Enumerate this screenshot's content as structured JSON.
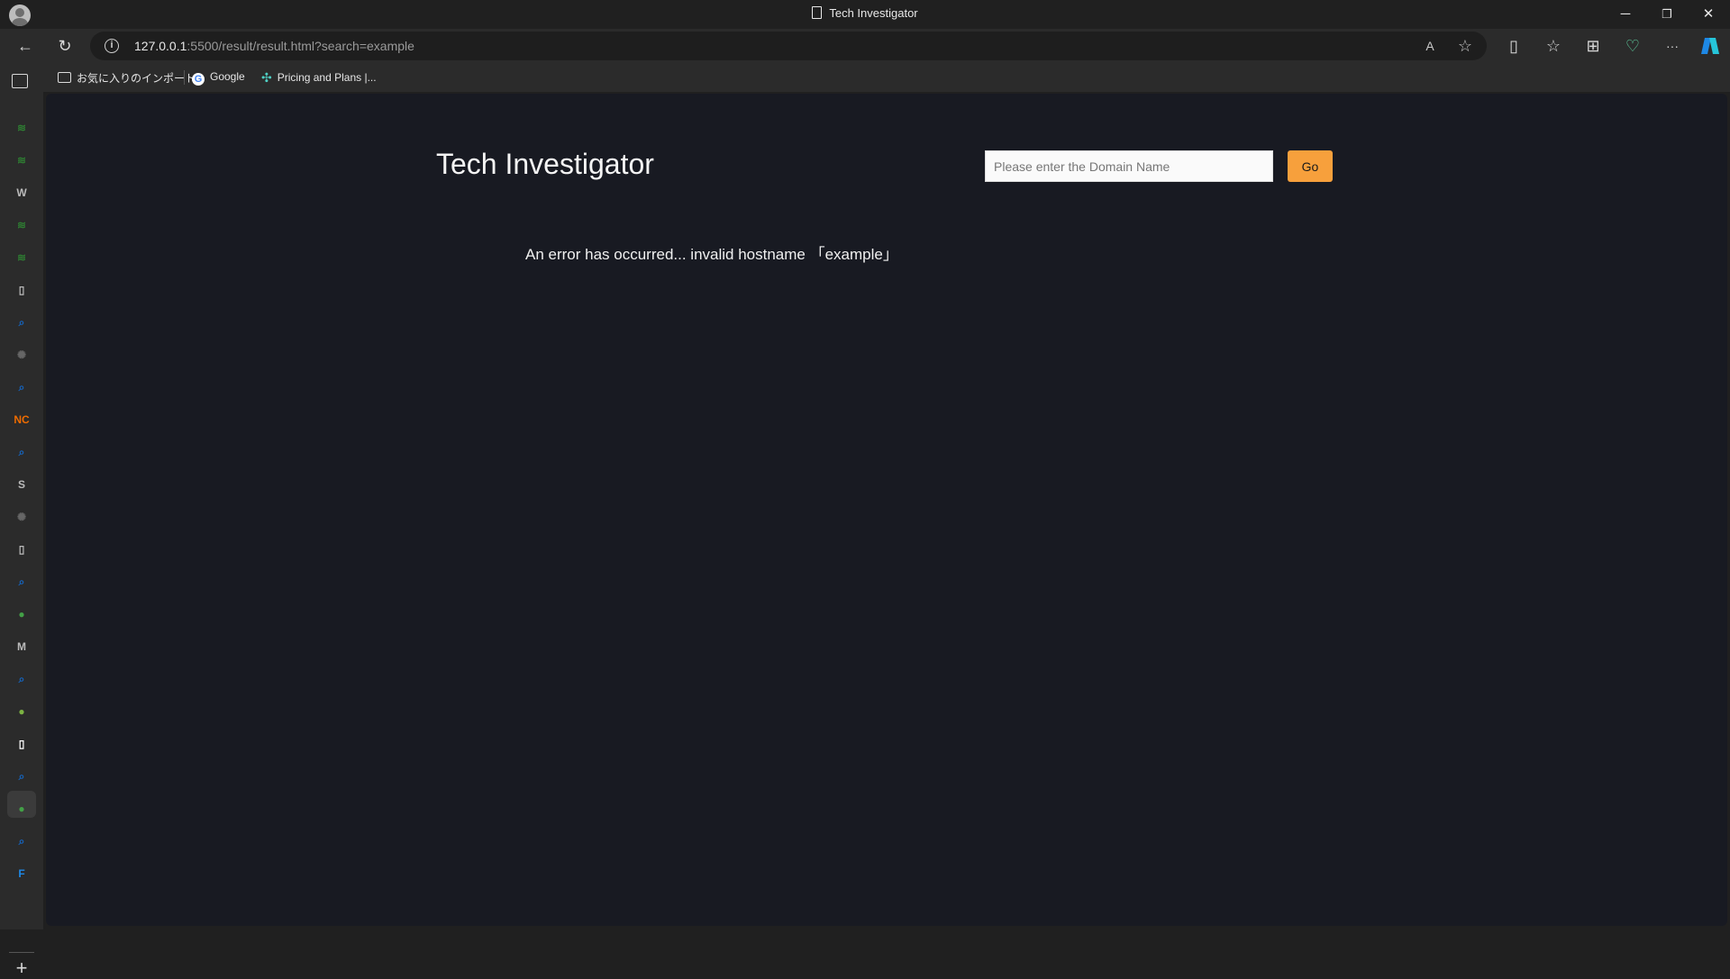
{
  "window": {
    "title": "Tech Investigator",
    "minimize": "─",
    "restore": "❐",
    "close": "✕"
  },
  "toolbar": {
    "back": "←",
    "refresh": "↻",
    "url_host": "127.0.0.1",
    "url_rest": ":5500/result/result.html?search=example",
    "read_aloud": "A",
    "favorite": "☆",
    "split": "▯",
    "favorites_list": "☆",
    "collections": "⊞",
    "health": "♡",
    "more": "···"
  },
  "bookmarks": [
    {
      "label": "お気に入りのインポート",
      "icon": "folder-import-icon"
    },
    {
      "label": "Google",
      "icon": "google-icon"
    },
    {
      "label": "Pricing and Plans |...",
      "icon": "pricing-icon"
    }
  ],
  "sidebar": {
    "items": [
      {
        "name": "tab-icon-1",
        "glyph": "≋",
        "color": "#2e7d32"
      },
      {
        "name": "tab-icon-2",
        "glyph": "≋",
        "color": "#2e7d32"
      },
      {
        "name": "wikipedia-icon",
        "glyph": "W",
        "color": "#bbbbbb"
      },
      {
        "name": "tab-icon-4",
        "glyph": "≋",
        "color": "#2e7d32"
      },
      {
        "name": "tab-icon-5",
        "glyph": "≋",
        "color": "#2e7d32"
      },
      {
        "name": "document-icon",
        "glyph": "▯",
        "color": "#bbbbbb"
      },
      {
        "name": "search-icon",
        "glyph": "⌕",
        "color": "#1565c0"
      },
      {
        "name": "openai-icon",
        "glyph": "✺",
        "color": "#666666"
      },
      {
        "name": "search-icon",
        "glyph": "⌕",
        "color": "#1565c0"
      },
      {
        "name": "nc-icon",
        "glyph": "NC",
        "color": "#ef6c00"
      },
      {
        "name": "search-icon",
        "glyph": "⌕",
        "color": "#1565c0"
      },
      {
        "name": "s-icon",
        "glyph": "S",
        "color": "#bbbbbb"
      },
      {
        "name": "openai-icon",
        "glyph": "✺",
        "color": "#666666"
      },
      {
        "name": "document-icon",
        "glyph": "▯",
        "color": "#bbbbbb"
      },
      {
        "name": "search-icon",
        "glyph": "⌕",
        "color": "#1565c0"
      },
      {
        "name": "green-circle-icon",
        "glyph": "●",
        "color": "#43a047"
      },
      {
        "name": "m-icon",
        "glyph": "M",
        "color": "#bbbbbb"
      },
      {
        "name": "search-icon",
        "glyph": "⌕",
        "color": "#1565c0"
      },
      {
        "name": "green-dot-icon",
        "glyph": "●",
        "color": "#7cb342"
      },
      {
        "name": "document-icon-active",
        "glyph": "▯",
        "color": "#ffffff"
      },
      {
        "name": "search-icon",
        "glyph": "⌕",
        "color": "#1565c0"
      },
      {
        "name": "green-circle-icon",
        "glyph": "●",
        "color": "#43a047"
      },
      {
        "name": "search-icon",
        "glyph": "⌕",
        "color": "#1565c0"
      },
      {
        "name": "f-icon",
        "glyph": "F",
        "color": "#1e88e5"
      }
    ],
    "add": "+"
  },
  "page": {
    "title": "Tech Investigator",
    "search_placeholder": "Please enter the Domain Name",
    "search_value": "",
    "go_label": "Go",
    "error_message": "An error has occurred... invalid hostname 「example」"
  },
  "colors": {
    "page_bg": "#181a22",
    "go_button": "#f7a03c",
    "browser_chrome": "#2b2b2b"
  }
}
